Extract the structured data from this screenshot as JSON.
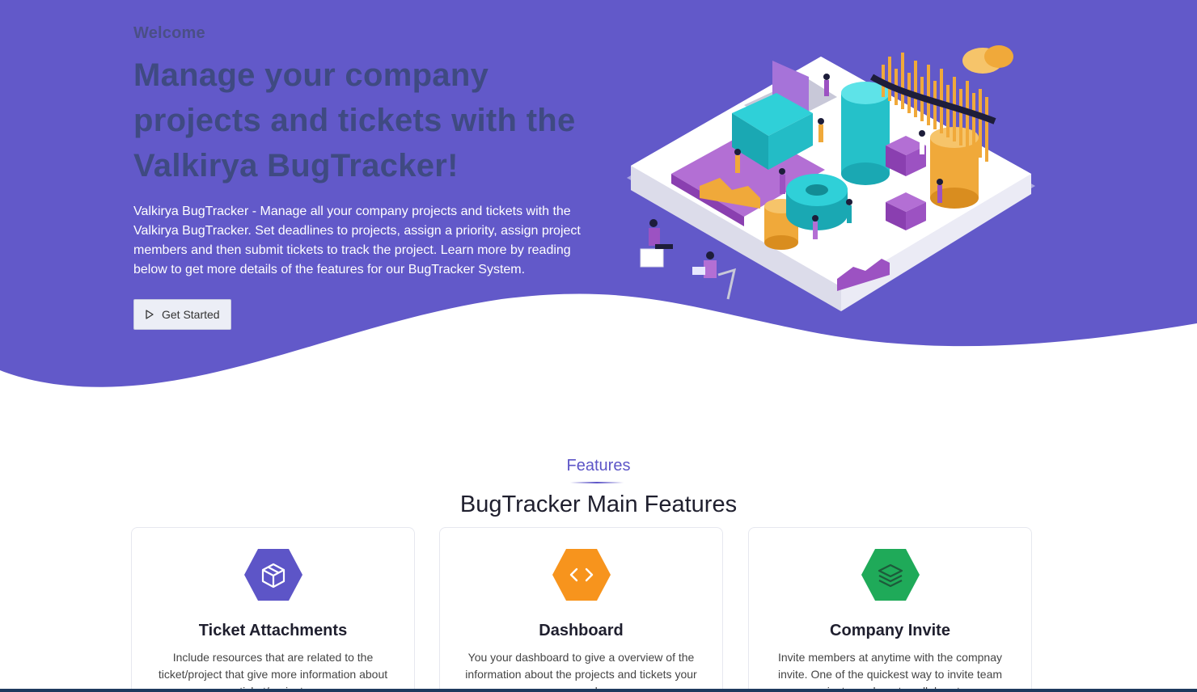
{
  "hero": {
    "welcome": "Welcome",
    "headline": "Manage your company projects and tickets with the Valkirya BugTracker!",
    "description": "Valkirya BugTracker - Manage all your company projects and tickets with the Valkirya BugTracker. Set deadlines to projects, assign a priority, assign project members and then submit tickets to track the project. Learn more by reading below to get more details of the features for our BugTracker System.",
    "button_label": "Get Started",
    "button_icon": "play-icon"
  },
  "features": {
    "kicker": "Features",
    "title": "BugTracker Main Features",
    "cards": [
      {
        "icon": "box-icon",
        "color": "#5d55c7",
        "title": "Ticket Attachments",
        "description": "Include resources that are related to the ticket/project that give more information about ticket/project."
      },
      {
        "icon": "code-icon",
        "color": "#f7941d",
        "title": "Dashboard",
        "description": "You your dashboard to give a overview of the information about the projects and tickets your company has."
      },
      {
        "icon": "layers-icon",
        "color": "#1faa59",
        "title": "Company Invite",
        "description": "Invite members at anytime with the compnay invite. One of the quickest way to invite team project members to collaborate."
      }
    ]
  },
  "colors": {
    "hero_background": "#6259c9",
    "headline": "#3f4a82",
    "accent": "#5d55c7"
  }
}
